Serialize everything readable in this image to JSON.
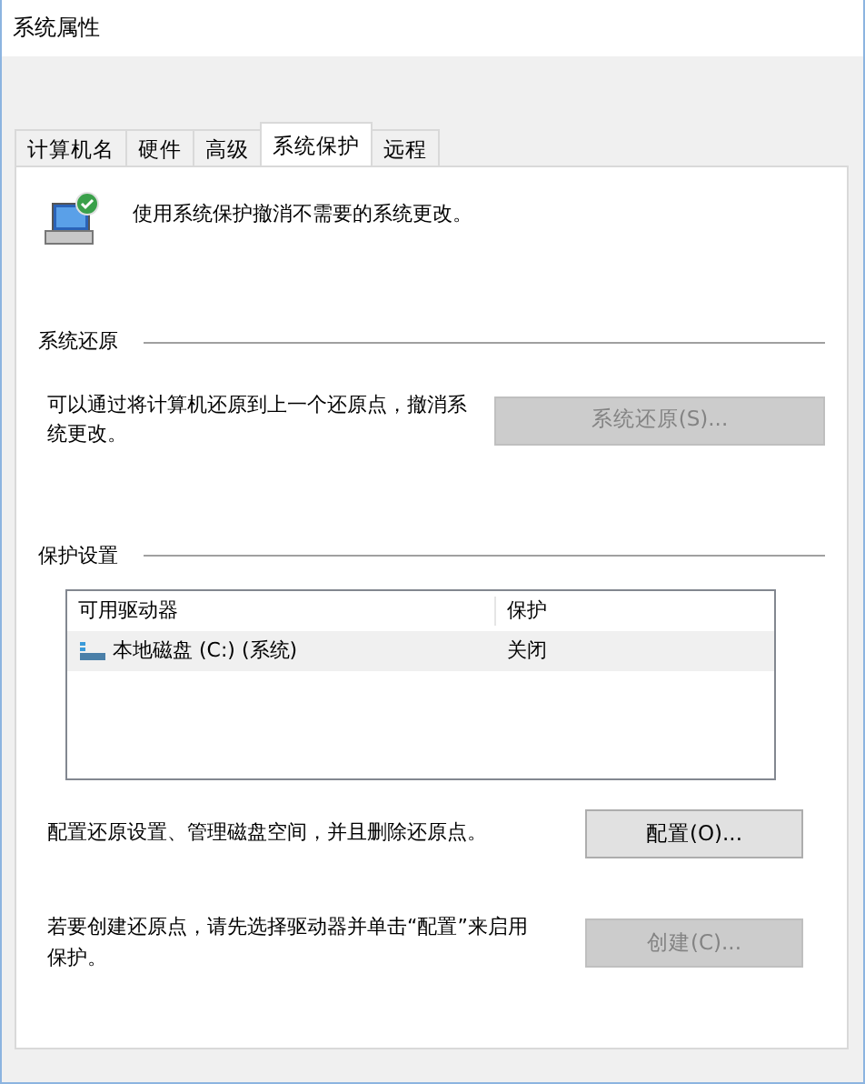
{
  "window": {
    "title": "系统属性"
  },
  "tabs": [
    {
      "label": "计算机名",
      "selected": false
    },
    {
      "label": "硬件",
      "selected": false
    },
    {
      "label": "高级",
      "selected": false
    },
    {
      "label": "系统保护",
      "selected": true
    },
    {
      "label": "远程",
      "selected": false
    }
  ],
  "intro": "使用系统保护撤消不需要的系统更改。",
  "system_restore": {
    "heading": "系统还原",
    "description": "可以通过将计算机还原到上一个还原点，撤消系统更改。",
    "button": {
      "label": "系统还原(S)...",
      "disabled": true
    }
  },
  "protection_settings": {
    "heading": "保护设置",
    "table": {
      "columns": [
        "可用驱动器",
        "保护"
      ],
      "rows": [
        {
          "drive": "本地磁盘 (C:) (系统)",
          "protection": "关闭",
          "selected": true
        }
      ]
    },
    "configure": {
      "description": "配置还原设置、管理磁盘空间，并且删除还原点。",
      "button": {
        "label": "配置(O)...",
        "disabled": false
      }
    },
    "create": {
      "description": "若要创建还原点，请先选择驱动器并单击“配置”来启用保护。",
      "button": {
        "label": "创建(C)...",
        "disabled": true
      }
    }
  }
}
